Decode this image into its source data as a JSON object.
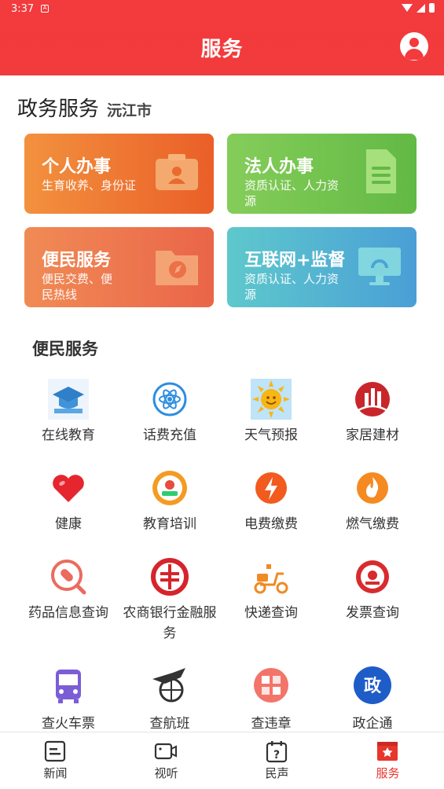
{
  "status": {
    "time": "3:37",
    "notif": "A"
  },
  "header": {
    "title": "服务"
  },
  "section": {
    "title": "政务服务",
    "city": "沅江市"
  },
  "cards": [
    {
      "title": "个人办事",
      "subtitle": "生育收养、身份证",
      "icon": "id-card-icon"
    },
    {
      "title": "法人办事",
      "subtitle": "资质认证、人力资源",
      "icon": "document-icon"
    },
    {
      "title": "便民服务",
      "subtitle": "便民交费、便民热线",
      "icon": "folder-compass-icon"
    },
    {
      "title": "互联网+监督",
      "subtitle": "资质认证、人力资源",
      "icon": "monitor-icon"
    }
  ],
  "convenience": {
    "title": "便民服务",
    "items": [
      {
        "label": "在线教育",
        "icon": "graduation-cap-icon"
      },
      {
        "label": "话费充值",
        "icon": "atom-icon"
      },
      {
        "label": "天气预报",
        "icon": "sun-icon"
      },
      {
        "label": "家居建材",
        "icon": "building-icon"
      },
      {
        "label": "健康",
        "icon": "heart-icon"
      },
      {
        "label": "教育培训",
        "icon": "education-badge-icon"
      },
      {
        "label": "电费缴费",
        "icon": "lightning-icon"
      },
      {
        "label": "燃气缴费",
        "icon": "flame-icon"
      },
      {
        "label": "药品信息查询",
        "icon": "pill-search-icon"
      },
      {
        "label": "农商银行金融服务",
        "icon": "bank-logo-icon"
      },
      {
        "label": "快递查询",
        "icon": "scooter-icon"
      },
      {
        "label": "发票查询",
        "icon": "tax-emblem-icon"
      },
      {
        "label": "查火车票",
        "icon": "bus-icon"
      },
      {
        "label": "查航班",
        "icon": "airplane-icon"
      },
      {
        "label": "查违章",
        "icon": "violation-icon"
      },
      {
        "label": "政企通",
        "icon": "government-icon"
      }
    ]
  },
  "nav": [
    {
      "label": "新闻",
      "icon": "news-icon"
    },
    {
      "label": "视听",
      "icon": "video-icon"
    },
    {
      "label": "民声",
      "icon": "calendar-question-icon"
    },
    {
      "label": "服务",
      "icon": "service-star-icon"
    }
  ],
  "colors": {
    "primary": "#f23b3d",
    "active_nav": "#e8352e"
  }
}
